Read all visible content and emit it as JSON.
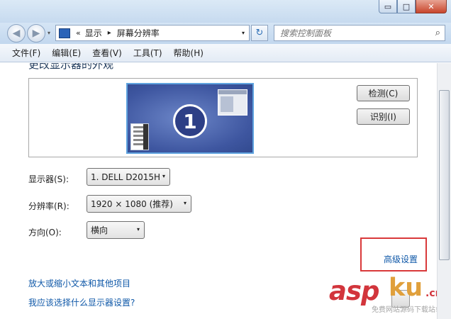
{
  "window": {
    "minimize_glyph": "▭",
    "maximize_glyph": "□",
    "close_glyph": "✕"
  },
  "nav": {
    "back_glyph": "◀",
    "forward_glyph": "▶",
    "dropdown_glyph": "▾",
    "breadcrumb_prefix": "«",
    "breadcrumbs": [
      "显示",
      "屏幕分辨率"
    ],
    "breadcrumb_separator": "▸",
    "refresh_glyph": "↻"
  },
  "search": {
    "placeholder": "搜索控制面板",
    "icon_glyph": "⌕"
  },
  "menu": {
    "items": [
      "文件(F)",
      "编辑(E)",
      "查看(V)",
      "工具(T)",
      "帮助(H)"
    ]
  },
  "main": {
    "heading": "更改显示器的外观",
    "monitor_number": "1",
    "detect_button": "检测(C)",
    "identify_button": "识别(I)",
    "display_label": "显示器(S):",
    "display_value": "1. DELL D2015H",
    "resolution_label": "分辨率(R):",
    "resolution_value": "1920 × 1080 (推荐)",
    "orientation_label": "方向(O):",
    "orientation_value": "横向",
    "advanced_link": "高级设置",
    "link_text_size": "放大或缩小文本和其他项目",
    "link_which_settings": "我应该选择什么显示器设置?"
  },
  "watermark": {
    "asp": "asp",
    "ku": "ku",
    "cn": ".cn",
    "sub": "免费网站源码下载站!"
  },
  "colors": {
    "accent_link": "#0f58a8",
    "highlight_box": "#d9393a"
  }
}
